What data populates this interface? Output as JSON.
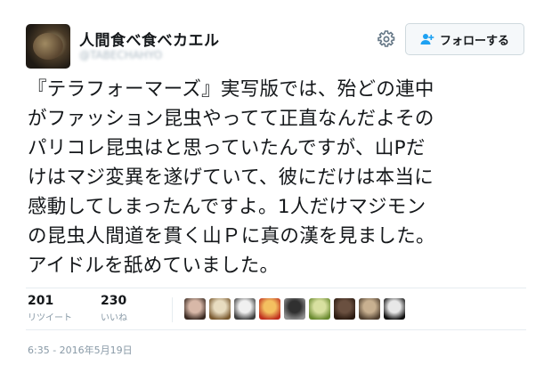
{
  "user": {
    "display_name": "人間食べ食べカエル",
    "handle": "@TABECHAHYO"
  },
  "follow_button": {
    "label": "フォローする",
    "icon": "person-add-icon"
  },
  "settings_icon": "gear-icon",
  "tweet": {
    "text": "『テラフォーマーズ』実写版では、殆どの連中\nがファッション昆虫やってて正直なんだよその\nパリコレ昆虫はと思っていたんですが、山Pだ\nけはマジ変異を遂げていて、彼にだけは本当に\n感動してしまったんですよ。1人だけマジモン\nの昆虫人間道を貫く山Ｐに真の漢を見ました。\nアイドルを舐めていました。"
  },
  "stats": {
    "retweets": {
      "count": "201",
      "label": "リツイート"
    },
    "likes": {
      "count": "230",
      "label": "いいね"
    }
  },
  "likers": [
    {
      "colors": [
        "#d8b8a8",
        "#3a2a22"
      ]
    },
    {
      "colors": [
        "#e8dcc0",
        "#7a5a30"
      ]
    },
    {
      "colors": [
        "#f0f0f0",
        "#404040"
      ]
    },
    {
      "colors": [
        "#f4c060",
        "#c03020"
      ]
    },
    {
      "colors": [
        "#303030",
        "#909090"
      ]
    },
    {
      "colors": [
        "#d8e0a0",
        "#6a8a30"
      ]
    },
    {
      "colors": [
        "#6a5040",
        "#2a1a10"
      ]
    },
    {
      "colors": [
        "#c8b090",
        "#504030"
      ]
    },
    {
      "colors": [
        "#e8e8e8",
        "#101010"
      ]
    }
  ],
  "timestamp": "6:35 - 2016年5月19日"
}
